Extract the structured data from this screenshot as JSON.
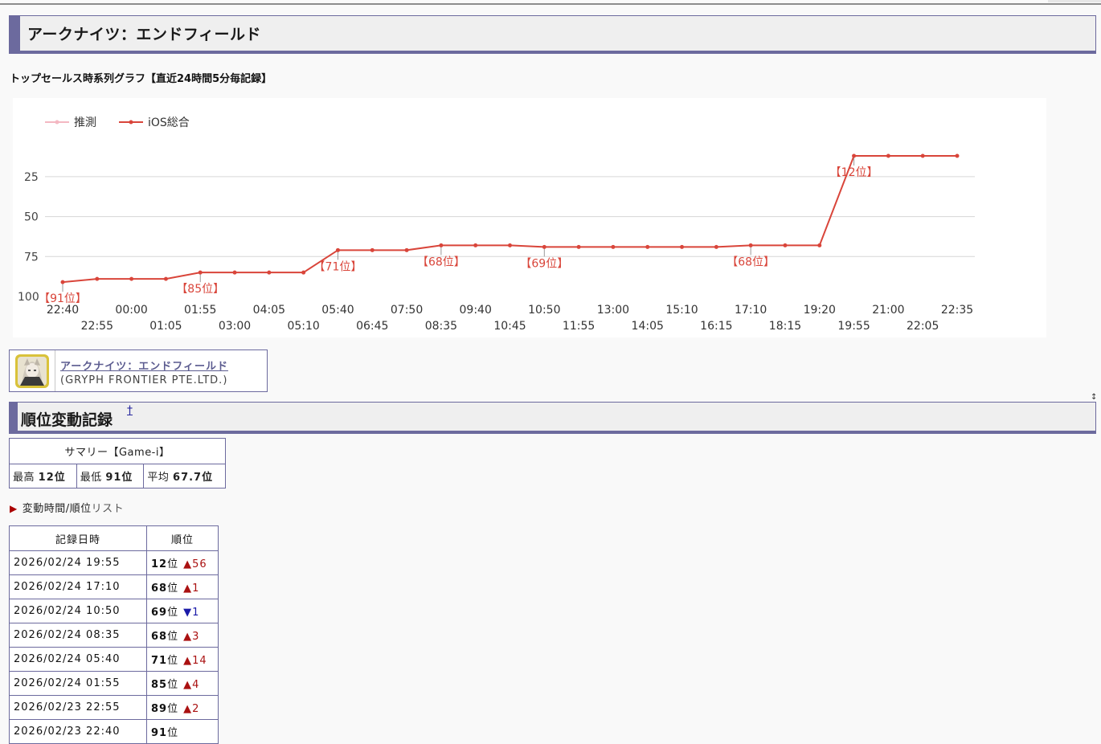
{
  "page": {
    "title": "アークナイツ：エンドフィールド",
    "graph_caption": "トップセールス時系列グラフ【直近24時間5分毎記録】"
  },
  "chart_data": {
    "type": "line",
    "legend": [
      "推測",
      "iOS総合"
    ],
    "legend_placement": "top-left",
    "y_reversed": true,
    "ylim": [
      100,
      12
    ],
    "yticks": [
      25,
      50,
      75,
      100
    ],
    "x_labels_row1": [
      "22:40",
      "00:00",
      "01:55",
      "04:05",
      "05:40",
      "07:50",
      "09:40",
      "10:50",
      "13:00",
      "15:10",
      "17:10",
      "19:20",
      "21:00",
      "22:35"
    ],
    "x_labels_row2": [
      "22:55",
      "01:05",
      "03:00",
      "05:10",
      "06:45",
      "08:35",
      "10:45",
      "11:55",
      "14:05",
      "16:15",
      "18:15",
      "19:55",
      "22:05"
    ],
    "x": [
      "22:40",
      "22:55",
      "00:00",
      "01:05",
      "01:55",
      "03:00",
      "04:05",
      "05:10",
      "05:40",
      "06:45",
      "07:50",
      "08:35",
      "09:40",
      "10:45",
      "10:50",
      "11:55",
      "13:00",
      "14:05",
      "15:10",
      "16:15",
      "17:10",
      "18:15",
      "19:20",
      "19:55",
      "21:00",
      "22:05",
      "22:35"
    ],
    "series": [
      {
        "name": "推測",
        "values": []
      },
      {
        "name": "iOS総合",
        "values": [
          91,
          89,
          89,
          89,
          85,
          85,
          85,
          85,
          71,
          71,
          71,
          68,
          68,
          68,
          69,
          69,
          69,
          69,
          69,
          69,
          68,
          68,
          68,
          12,
          12,
          12,
          12
        ]
      }
    ],
    "annotations": [
      {
        "index": 0,
        "text": "【91位】"
      },
      {
        "index": 4,
        "text": "【85位】"
      },
      {
        "index": 8,
        "text": "【71位】"
      },
      {
        "index": 11,
        "text": "【68位】"
      },
      {
        "index": 14,
        "text": "【69位】"
      },
      {
        "index": 20,
        "text": "【68位】"
      },
      {
        "index": 23,
        "text": "【12位】"
      }
    ],
    "colors": {
      "推測": "#f4b8c2",
      "iOS総合": "#d9453a"
    },
    "grid": true
  },
  "app": {
    "name": "アークナイツ：エンドフィールド",
    "developer": "(GRYPH FRONTIER PTE.LTD.)"
  },
  "section": {
    "title": "順位変動記録",
    "dagger": "†",
    "corner_arrow": "↕"
  },
  "summary": {
    "header": "サマリー【Game-i】",
    "best_label": "最高",
    "best_value": "12位",
    "worst_label": "最低",
    "worst_value": "91位",
    "avg_label": "平均",
    "avg_value": "67.7位"
  },
  "toggle": {
    "label": "変動時間/順位",
    "tail": "リスト"
  },
  "records": {
    "headers": [
      "記録日時",
      "順位"
    ],
    "rows": [
      {
        "date": "2026/02/24 19:55",
        "rank": "12",
        "unit": "位",
        "change": "▲56",
        "dir": "up"
      },
      {
        "date": "2026/02/24 17:10",
        "rank": "68",
        "unit": "位",
        "change": "▲1",
        "dir": "up"
      },
      {
        "date": "2026/02/24 10:50",
        "rank": "69",
        "unit": "位",
        "change": "▼1",
        "dir": "down"
      },
      {
        "date": "2026/02/24 08:35",
        "rank": "68",
        "unit": "位",
        "change": "▲3",
        "dir": "up"
      },
      {
        "date": "2026/02/24 05:40",
        "rank": "71",
        "unit": "位",
        "change": "▲14",
        "dir": "up"
      },
      {
        "date": "2026/02/24 01:55",
        "rank": "85",
        "unit": "位",
        "change": "▲4",
        "dir": "up"
      },
      {
        "date": "2026/02/23 22:55",
        "rank": "89",
        "unit": "位",
        "change": "▲2",
        "dir": "up"
      },
      {
        "date": "2026/02/23 22:40",
        "rank": "91",
        "unit": "位",
        "change": "",
        "dir": "none"
      }
    ]
  }
}
